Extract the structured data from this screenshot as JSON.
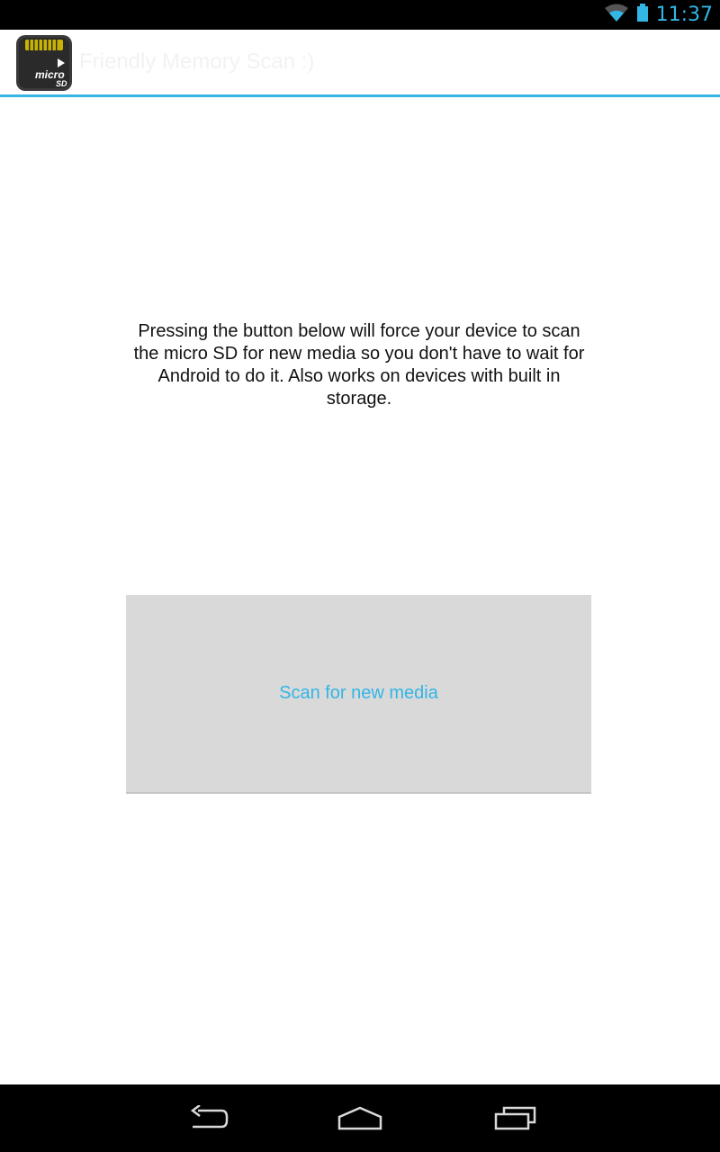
{
  "status_bar": {
    "time": "11:37",
    "icons": [
      "wifi-icon",
      "battery-icon"
    ]
  },
  "action_bar": {
    "app_icon": "micro-sd-icon",
    "title": "Friendly Memory Scan :)"
  },
  "main": {
    "description": "Pressing the button below will force your device to scan the micro SD for new media so you don't have to wait for Android to do it. Also works on devices with built in storage.",
    "scan_button_label": "Scan for new media"
  },
  "nav_bar": {
    "icons": [
      "back-icon",
      "home-icon",
      "recent-apps-icon"
    ]
  },
  "colors": {
    "accent": "#33b5e5",
    "button_bg": "#d9d9d9"
  }
}
